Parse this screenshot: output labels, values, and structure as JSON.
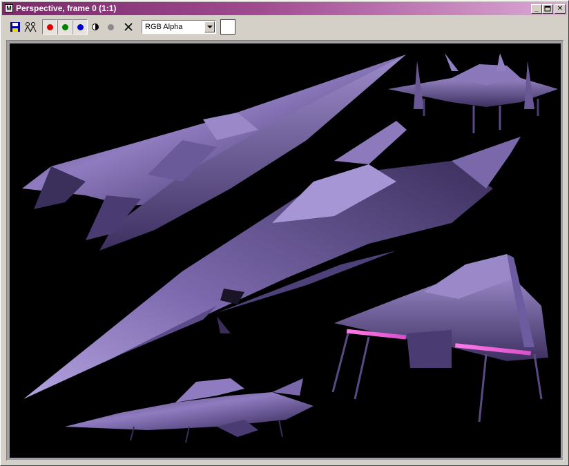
{
  "window": {
    "title": "Perspective, frame 0 (1:1)",
    "app_icon": "max-icon",
    "controls": [
      "minimize-icon",
      "maximize-icon",
      "close-icon"
    ]
  },
  "toolbar": {
    "save": "save-icon",
    "clone": "clone-icon",
    "channels": [
      {
        "name": "red-channel",
        "color": "#e00000"
      },
      {
        "name": "green-channel",
        "color": "#008000"
      },
      {
        "name": "blue-channel",
        "color": "#0000d0"
      }
    ],
    "alpha": "alpha-channel-icon",
    "mono": "monochrome-icon",
    "clear": "clear-icon",
    "channel_select": {
      "value": "RGB Alpha"
    },
    "swatch_color": "#ffffff"
  },
  "viewport": {
    "background": "#000000",
    "render_subjects": [
      "ship-large-top-left",
      "ship-front-view",
      "ship-center-diagonal",
      "ship-rear-view",
      "ship-side-view"
    ]
  }
}
